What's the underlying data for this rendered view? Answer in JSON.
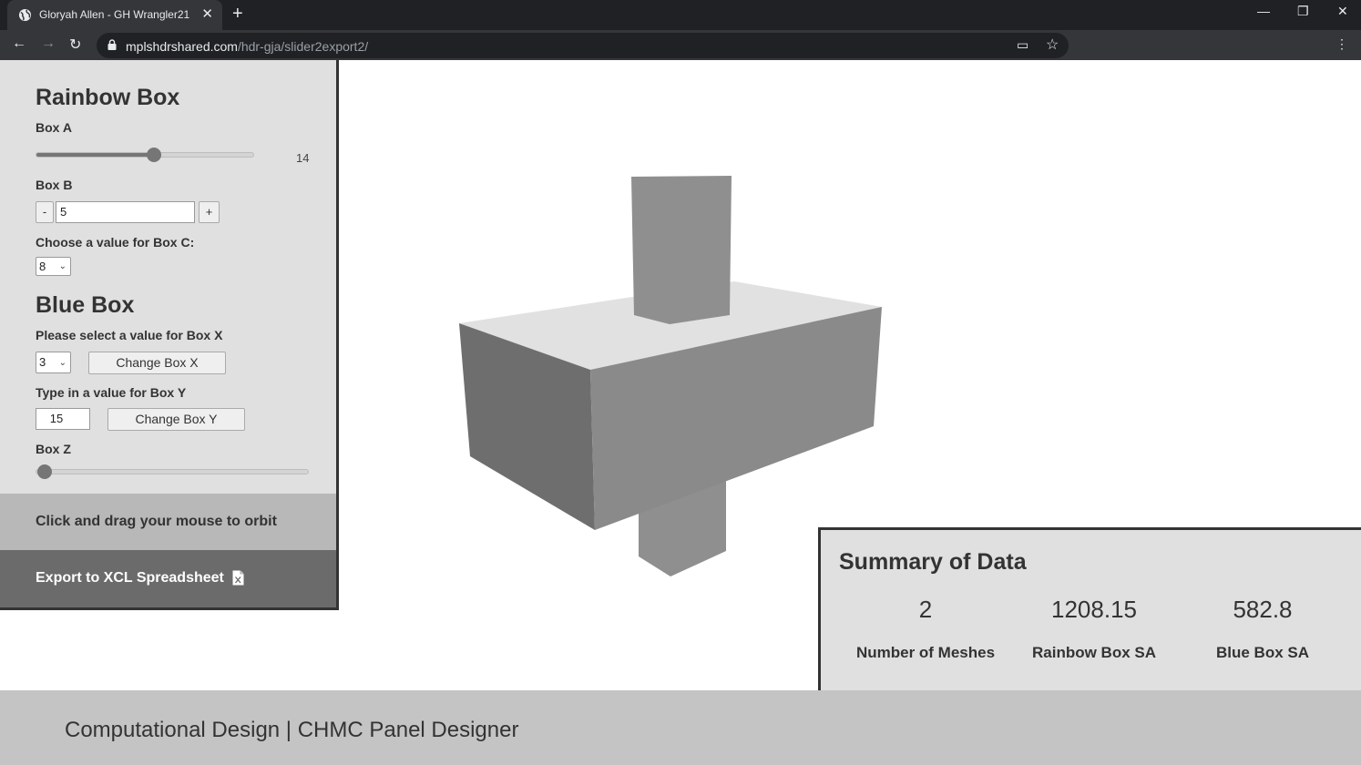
{
  "browser": {
    "tab_title": "Gloryah Allen - GH Wrangler21",
    "tab_close": "✕",
    "new_tab": "+",
    "url_domain": "mplshdrshared.com",
    "url_path": "/hdr-gja/slider2export2/",
    "back": "←",
    "forward": "→",
    "reload": "↻",
    "minimize": "—",
    "restore": "❐",
    "close": "✕",
    "bookmark": "☆",
    "cast": "▭",
    "menu": "⋮"
  },
  "panel": {
    "rainbow_title": "Rainbow Box",
    "box_a_label": "Box A",
    "box_a_value": "14",
    "box_a_fraction": 0.54,
    "box_b_label": "Box B",
    "box_b_minus": "-",
    "box_b_value": "5",
    "box_b_plus": "+",
    "box_c_label": "Choose a value for Box C:",
    "box_c_value": "8",
    "blue_title": "Blue Box",
    "box_x_label": "Please select a value for Box X",
    "box_x_value": "3",
    "change_x": "Change Box X",
    "box_y_label": "Type in a value for Box Y",
    "box_y_value": "15",
    "change_y": "Change Box Y",
    "box_z_label": "Box Z",
    "box_z_fraction": 0.0,
    "orbit_text": "Click and drag your mouse to orbit",
    "export_text": "Export to XCL Spreadsheet"
  },
  "summary": {
    "title": "Summary of Data",
    "meshes_value": "2",
    "meshes_label": "Number of Meshes",
    "rainbow_sa_value": "1208.15",
    "rainbow_sa_label": "Rainbow Box SA",
    "blue_sa_value": "582.8",
    "blue_sa_label": "Blue Box SA"
  },
  "footer": {
    "text": "Computational Design | CHMC Panel Designer"
  },
  "colors": {
    "panel_bg": "#e0e0e0",
    "export_bg": "#6b6b6b",
    "orbit_bg": "#b8b8b8",
    "footer_bg": "#c4c4c4",
    "box_top": "#e1e1e1",
    "box_left": "#6e6e6e",
    "box_front": "#8a8a8a"
  }
}
